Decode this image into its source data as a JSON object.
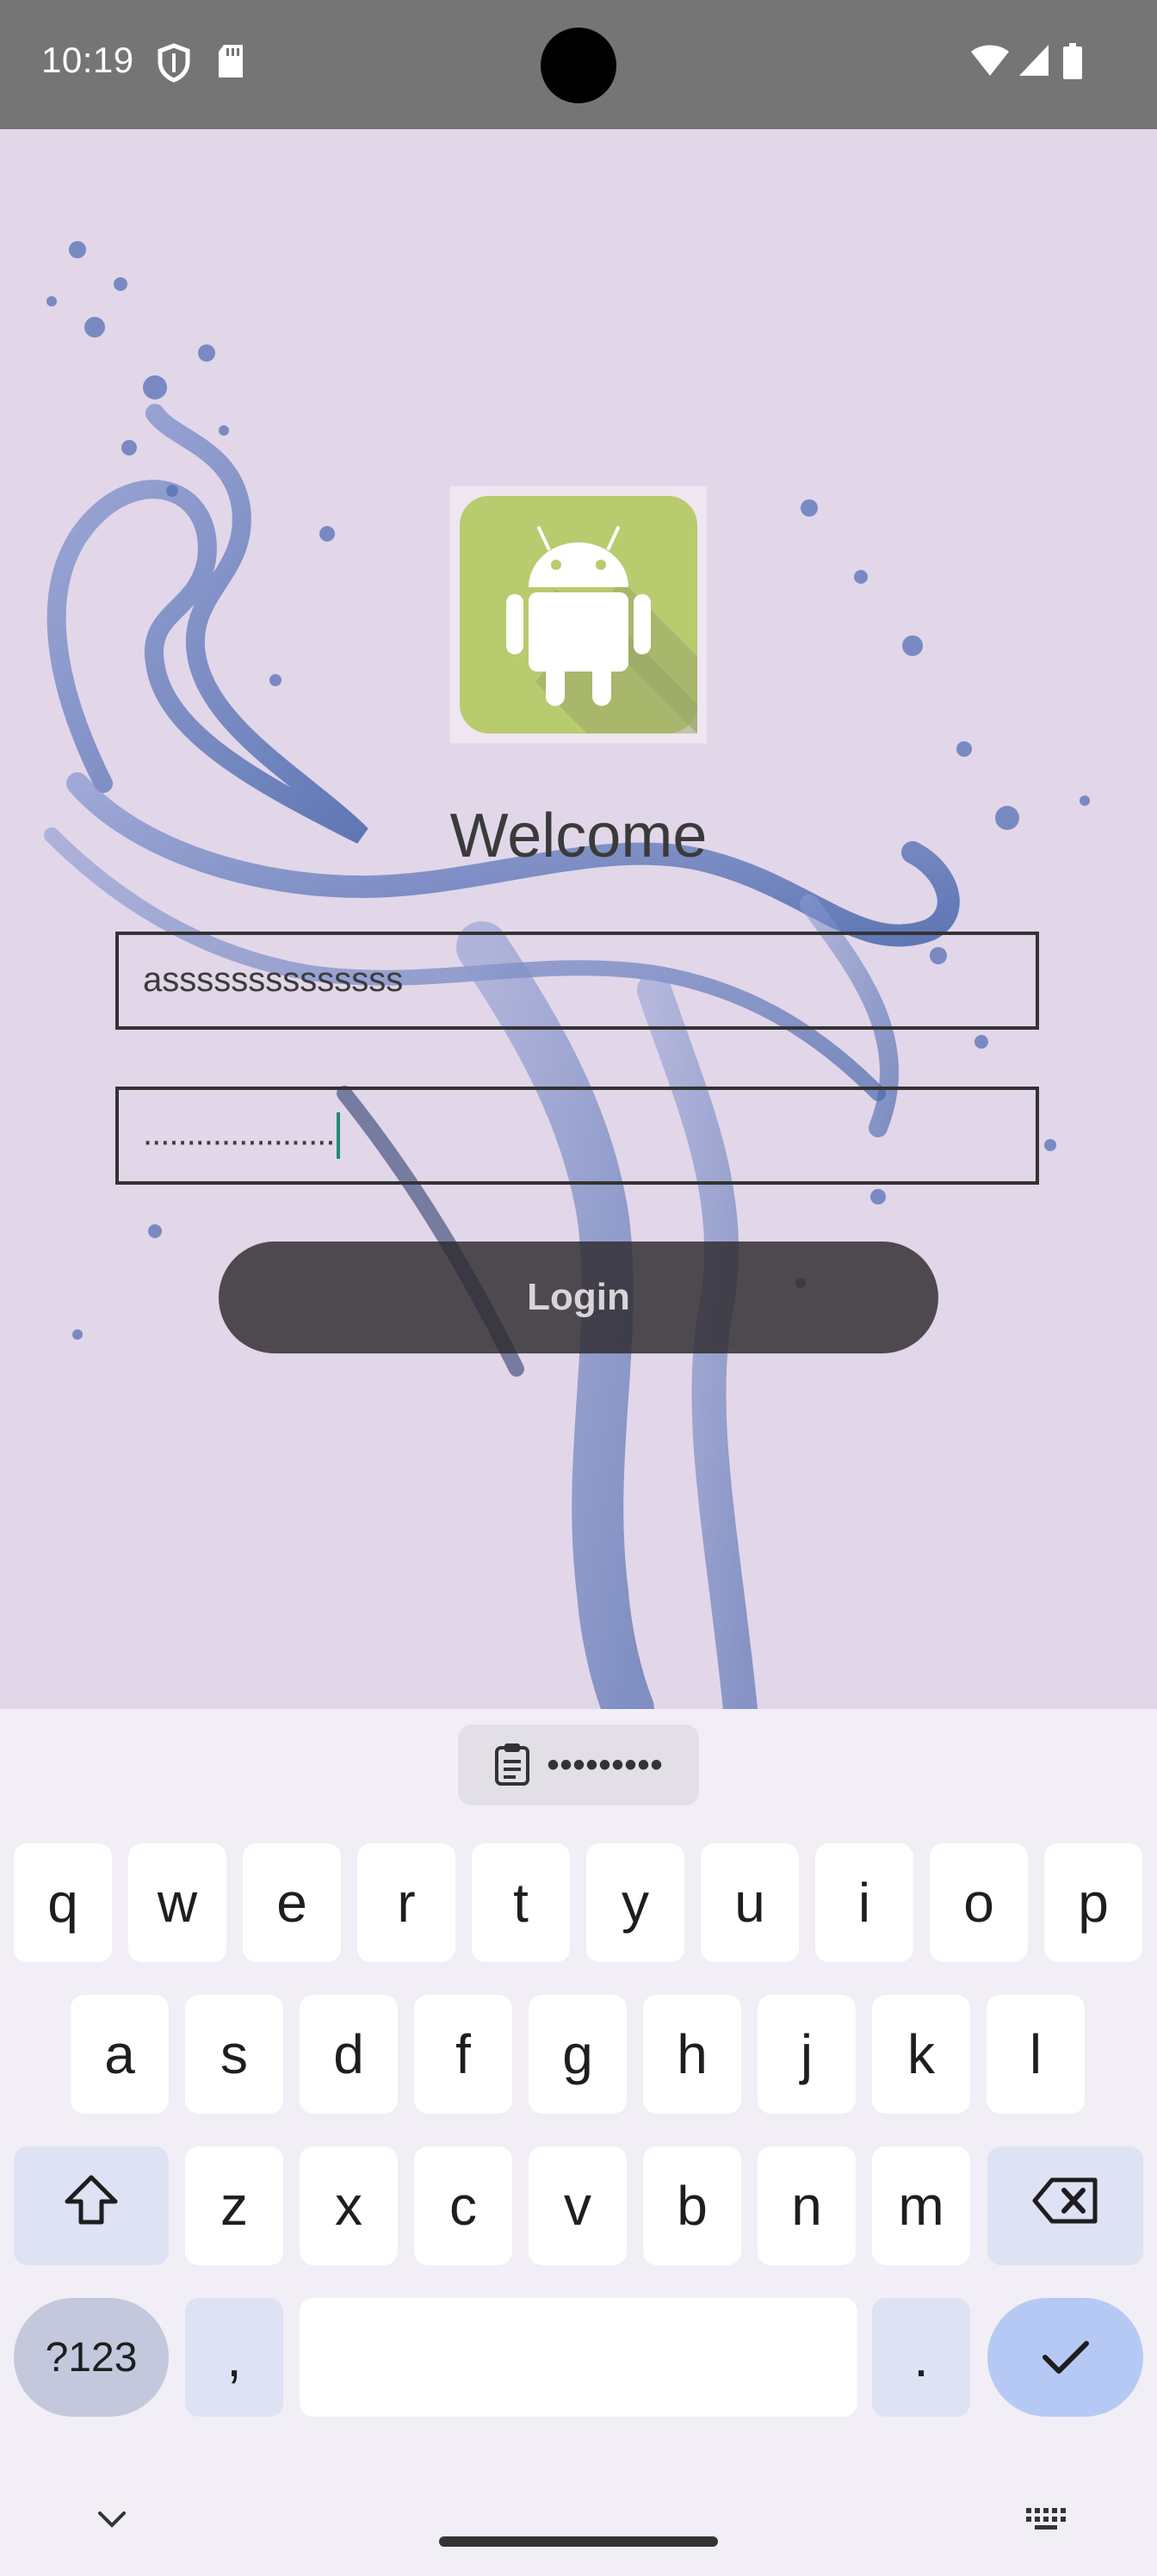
{
  "status_bar": {
    "time": "10:19",
    "icons": [
      "shield-icon",
      "sd-card-icon",
      "wifi-icon",
      "signal-icon",
      "battery-icon"
    ],
    "background": "#757575"
  },
  "app": {
    "background": "#e2d6e9",
    "logo": "android-logo",
    "welcome_text": "Welcome",
    "username": {
      "value": "assssssssssssss"
    },
    "password": {
      "value": "......................"
    },
    "login_label": "Login"
  },
  "keyboard": {
    "clipboard_chip": {
      "icon": "clipboard-icon",
      "masked_text": "•••••••••"
    },
    "row1": [
      "q",
      "w",
      "e",
      "r",
      "t",
      "y",
      "u",
      "i",
      "o",
      "p"
    ],
    "row2": [
      "a",
      "s",
      "d",
      "f",
      "g",
      "h",
      "j",
      "k",
      "l"
    ],
    "row3": [
      "z",
      "x",
      "c",
      "v",
      "b",
      "n",
      "m"
    ],
    "symbols_label": "?123",
    "comma_label": ",",
    "period_label": ".",
    "space_label": "",
    "icons": {
      "shift": "shift-icon",
      "backspace": "backspace-icon",
      "enter": "check-icon",
      "hide": "chevron-down-icon",
      "switch": "keyboard-icon"
    }
  }
}
